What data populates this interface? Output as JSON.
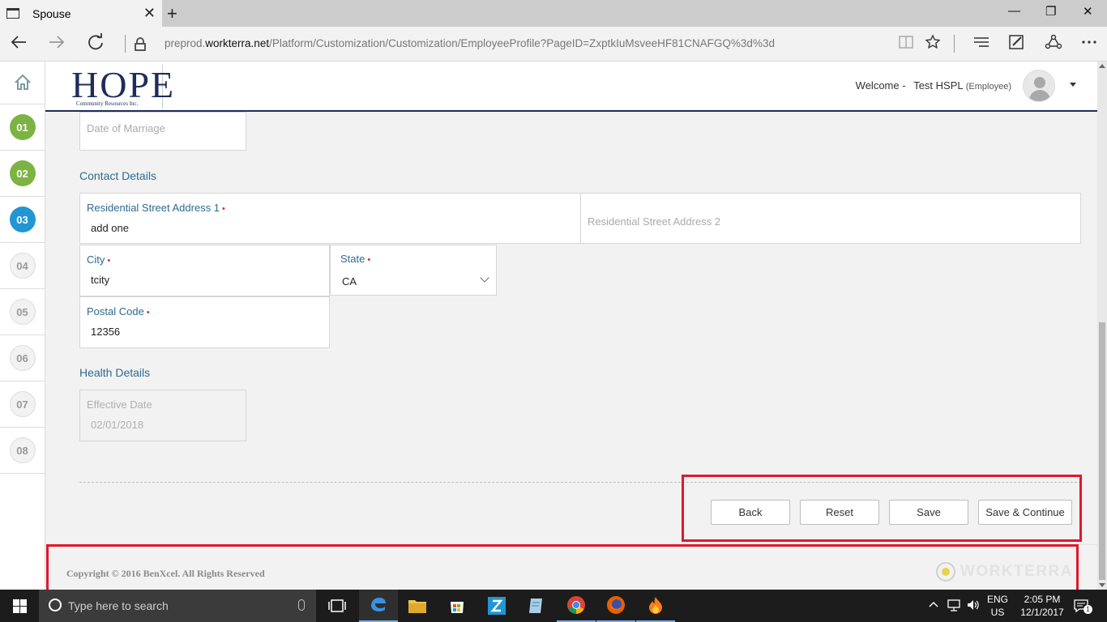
{
  "browser": {
    "tab_title": "Spouse",
    "close_tab": "✕",
    "new_tab": "+",
    "url_prefix": "preprod.",
    "url_domain": "workterra.net",
    "url_path": "/Platform/Customization/Customization/EmployeeProfile?PageID=ZxptkIuMsveeHF81CNAFGQ%3d%3d",
    "icons": [
      "back-arrow-icon",
      "forward-arrow-icon",
      "refresh-icon",
      "lock-icon",
      "reading-view-icon",
      "favorite-star-icon",
      "hub-icon",
      "web-note-icon",
      "share-icon",
      "more-icon"
    ],
    "win_minimize": "—",
    "win_restore": "❐",
    "win_close": "✕"
  },
  "sidebar": {
    "steps": [
      {
        "label": "01",
        "state": "done"
      },
      {
        "label": "02",
        "state": "done"
      },
      {
        "label": "03",
        "state": "active"
      },
      {
        "label": "04",
        "state": "todo"
      },
      {
        "label": "05",
        "state": "todo"
      },
      {
        "label": "06",
        "state": "todo"
      },
      {
        "label": "07",
        "state": "todo"
      },
      {
        "label": "08",
        "state": "todo"
      }
    ]
  },
  "header": {
    "logo_text": "HOPE",
    "logo_sub": "Community Resources Inc.",
    "welcome": "Welcome -",
    "user_name": "Test HSPL",
    "user_role": "(Employee)"
  },
  "form": {
    "date_of_marriage_placeholder": "Date of Marriage",
    "contact_title": "Contact Details",
    "address1_label": "Residential Street Address 1",
    "address1_value": "add one",
    "address2_placeholder": "Residential Street Address 2",
    "city_label": "City",
    "city_value": "tcity",
    "state_label": "State",
    "state_value": "CA",
    "postal_label": "Postal Code",
    "postal_value": "12356",
    "required_mark": "•",
    "health_title": "Health Details",
    "effective_label": "Effective Date",
    "effective_value": "02/01/2018"
  },
  "buttons": {
    "back": "Back",
    "reset": "Reset",
    "save": "Save",
    "save_continue": "Save & Continue"
  },
  "footer": {
    "copyright": "Copyright © 2016 BenXcel. All Rights Reserved",
    "brand": "WORKTERRA"
  },
  "taskbar": {
    "search_placeholder": "Type here to search",
    "lang_top": "ENG",
    "lang_bottom": "US",
    "time": "2:05 PM",
    "date": "12/1/2017",
    "notification_count": "1"
  },
  "colors": {
    "accent_green": "#7cb342",
    "accent_blue": "#2196d3",
    "highlight_red": "#e0182b",
    "label_blue": "#2e6b8f"
  }
}
